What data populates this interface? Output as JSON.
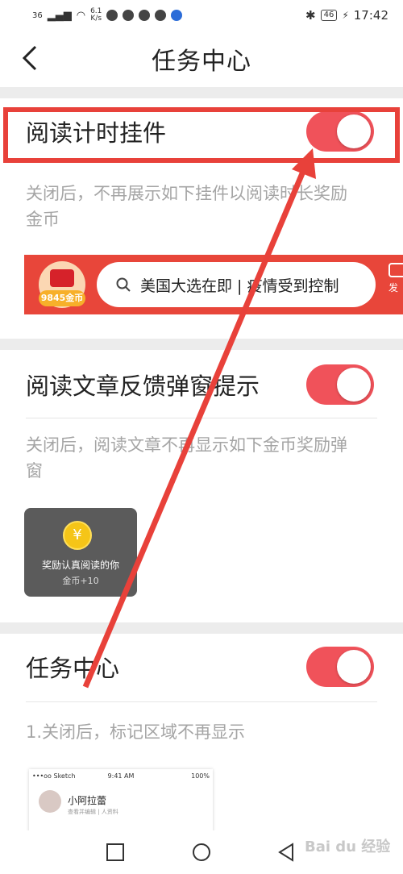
{
  "status_bar": {
    "signal": "36",
    "net_speed_value": "6.1",
    "net_speed_unit": "K/s",
    "battery": "46",
    "time": "17:42"
  },
  "header": {
    "title": "任务中心"
  },
  "section1": {
    "label": "阅读计时挂件",
    "toggle_on": true,
    "desc_line1": "关闭后，不再展示如下挂件以阅读时长奖励",
    "desc_line2": "金币",
    "widget": {
      "coin_text": "9845金币",
      "search_text": "美国大选在即 | 疫情受到控制",
      "publish_label": "发"
    }
  },
  "section2": {
    "label": "阅读文章反馈弹窗提示",
    "toggle_on": true,
    "desc_line1": "关闭后，阅读文章不再显示如下金币奖励弹",
    "desc_line2": "窗",
    "popup": {
      "coin_symbol": "¥",
      "line1": "奖励认真阅读的你",
      "line2": "金币+10"
    }
  },
  "section3": {
    "label": "任务中心",
    "toggle_on": true,
    "desc": "1.关闭后，标记区域不再显示",
    "preview": {
      "carrier": "•••oo Sketch",
      "time": "9:41 AM",
      "battery": "100%",
      "name": "小阿拉蕾",
      "sub": "查看并编辑 | 人资料"
    }
  },
  "watermark": "Bai du 经验",
  "colors": {
    "accent": "#f0525a",
    "annotation": "#e8413a",
    "banner": "#e8463a"
  }
}
